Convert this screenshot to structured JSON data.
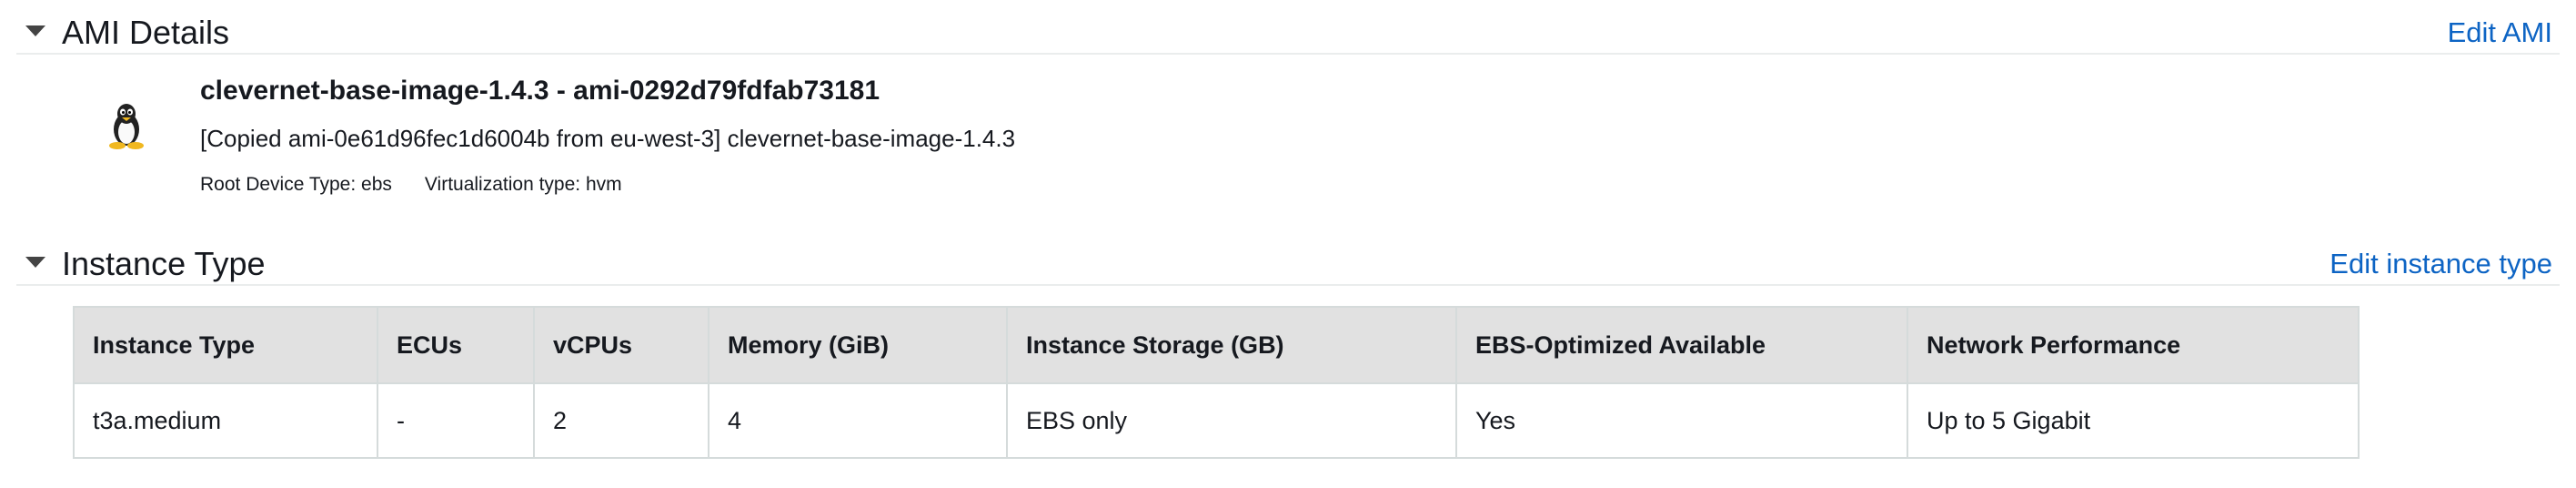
{
  "ami_section": {
    "title": "AMI Details",
    "edit_label": "Edit AMI",
    "ami_name": "clevernet-base-image-1.4.3 - ami-0292d79fdfab73181",
    "description": "[Copied ami-0e61d96fec1d6004b from eu-west-3] clevernet-base-image-1.4.3",
    "root_device": "Root Device Type: ebs",
    "virtualization": "Virtualization type: hvm",
    "os_icon": "linux-tux-icon"
  },
  "instance_section": {
    "title": "Instance Type",
    "edit_label": "Edit instance type",
    "table": {
      "headers": [
        "Instance Type",
        "ECUs",
        "vCPUs",
        "Memory (GiB)",
        "Instance Storage (GB)",
        "EBS-Optimized Available",
        "Network Performance"
      ],
      "rows": [
        [
          "t3a.medium",
          "-",
          "2",
          "4",
          "EBS only",
          "Yes",
          "Up to 5 Gigabit"
        ]
      ]
    }
  },
  "colors": {
    "link": "#0d64c4",
    "header_bg": "#e1e1e1",
    "border": "#d5dbdb"
  }
}
